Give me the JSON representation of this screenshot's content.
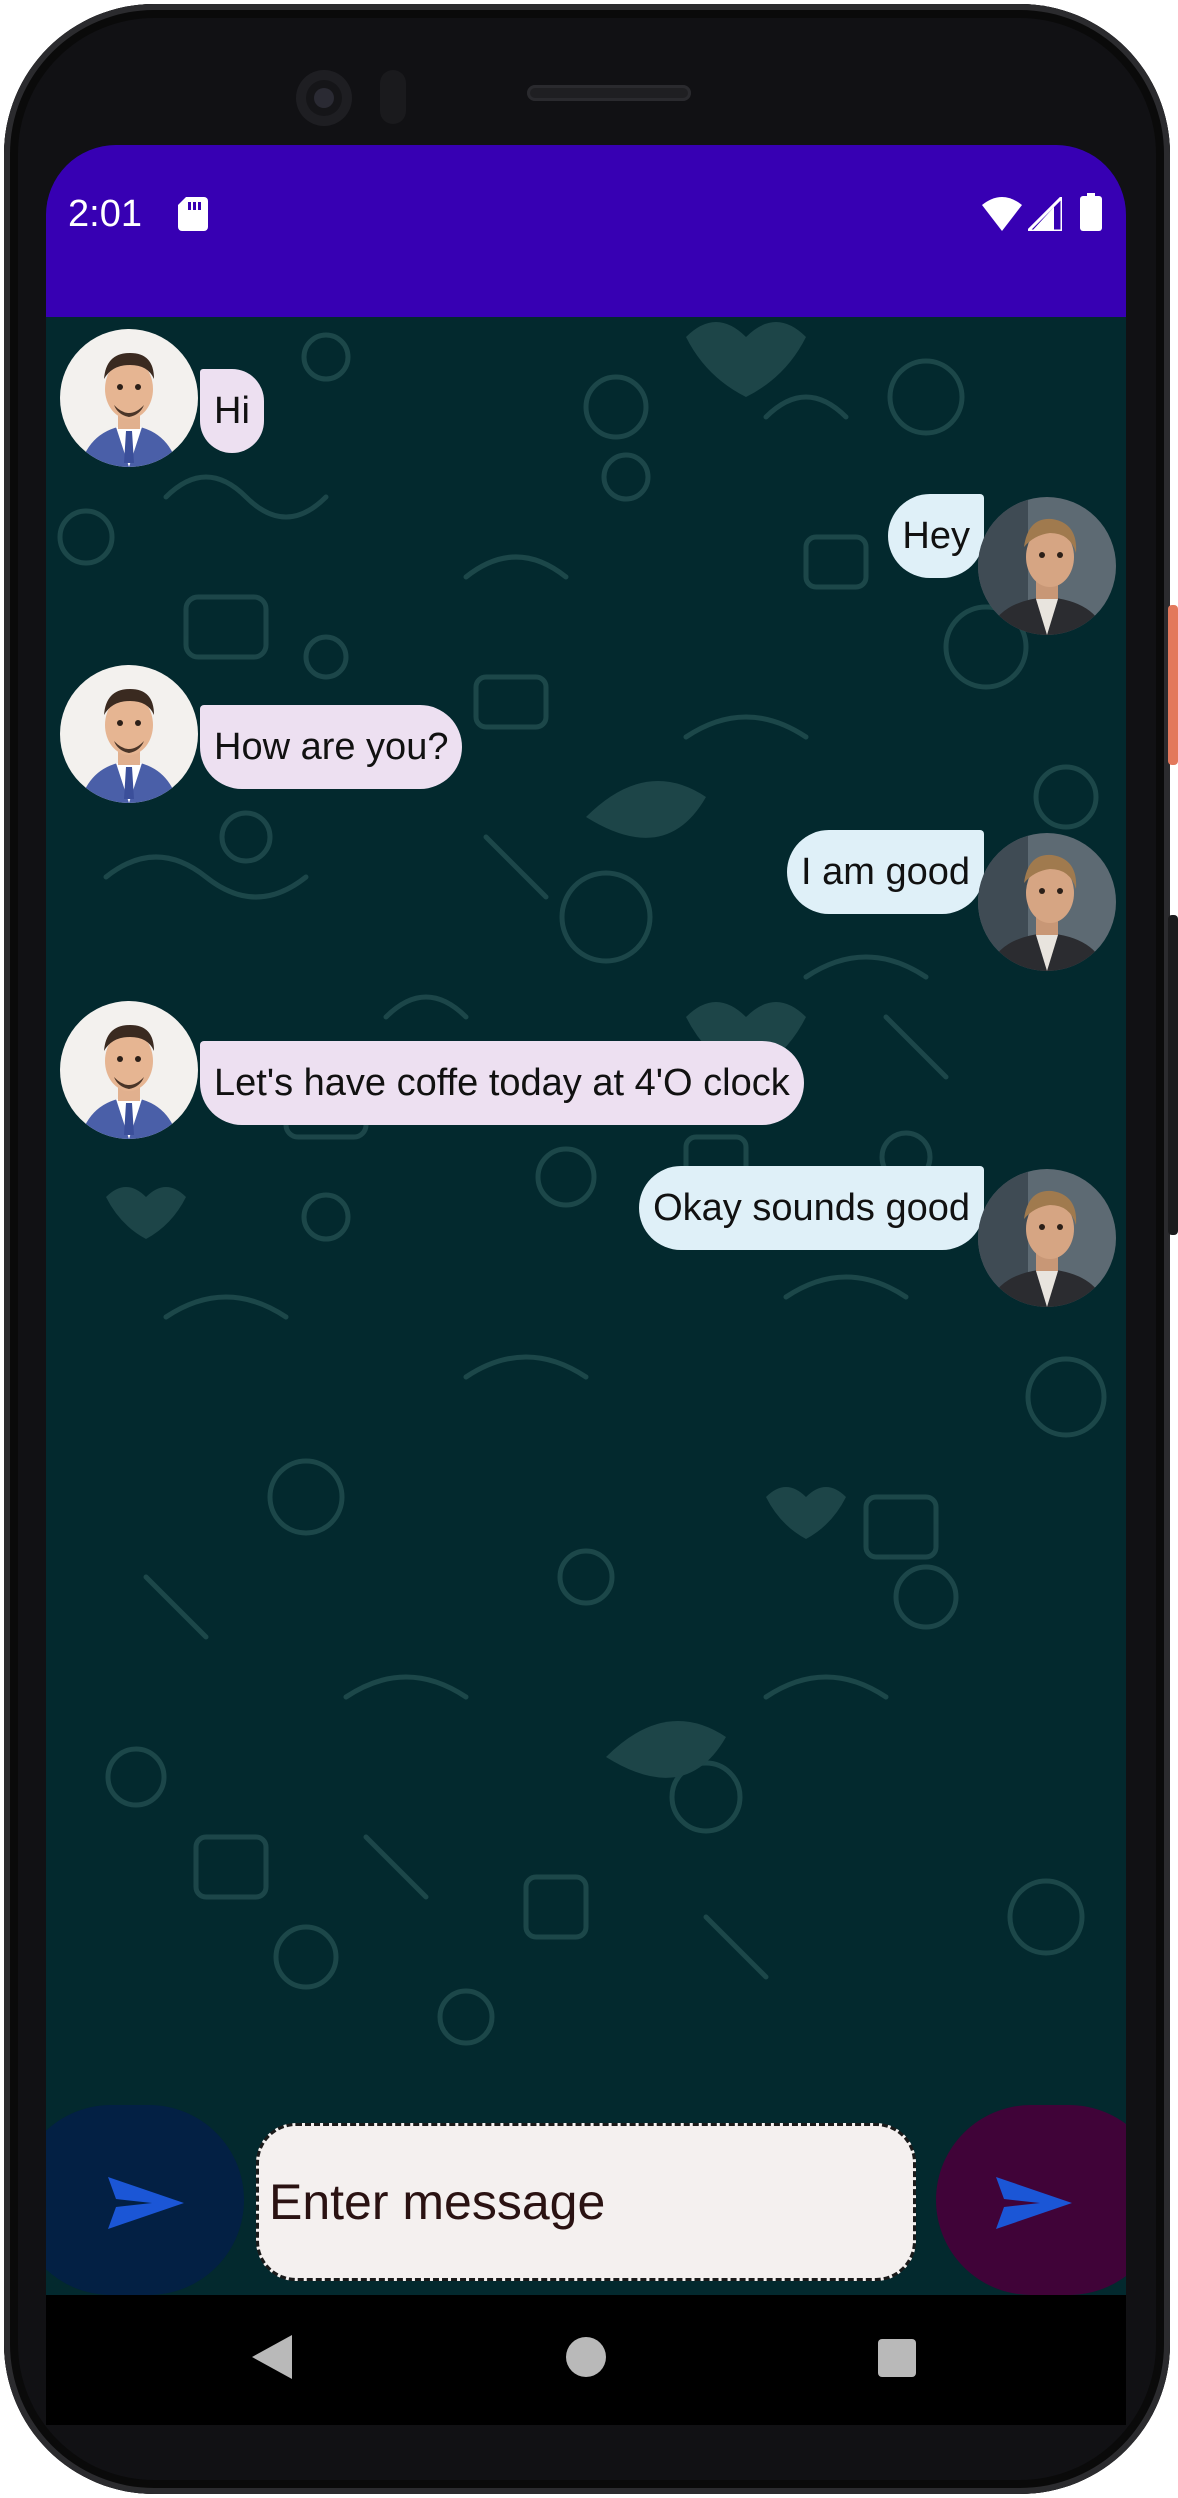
{
  "status_bar": {
    "time": "2:01",
    "color": "#3700b3",
    "icons": [
      "sd-card-icon",
      "wifi-icon",
      "cell-signal-icon",
      "battery-icon"
    ]
  },
  "chat": {
    "background_color": "#03292e",
    "incoming_bubble_color": "#ede0f1",
    "outgoing_bubble_color": "#dff0f8",
    "messages": [
      {
        "sender": "incoming",
        "text": "Hi"
      },
      {
        "sender": "outgoing",
        "text": "Hey"
      },
      {
        "sender": "incoming",
        "text": "How are you?"
      },
      {
        "sender": "outgoing",
        "text": "I am good"
      },
      {
        "sender": "incoming",
        "text": "Let's have coffe today at 4'O clock"
      },
      {
        "sender": "outgoing",
        "text": "Okay sounds good"
      }
    ]
  },
  "composer": {
    "placeholder": "Enter message",
    "value": "",
    "left_button_icon": "send-icon",
    "right_button_icon": "send-icon",
    "left_button_color": "#032044",
    "right_button_color": "#400338",
    "send_icon_color": "#1b56d6"
  },
  "nav_bar": {
    "icons": [
      "back-icon",
      "home-icon",
      "recents-icon"
    ]
  }
}
